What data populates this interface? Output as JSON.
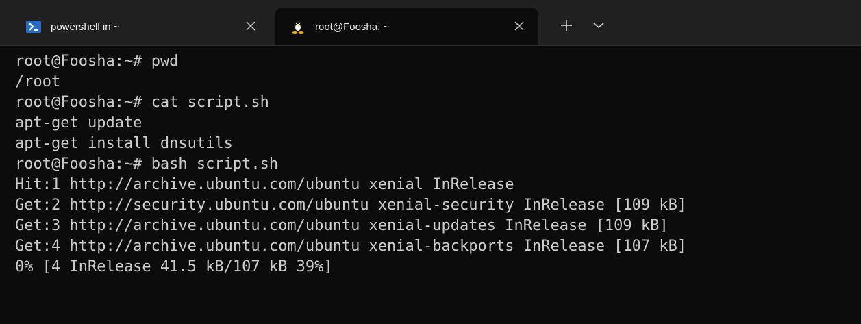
{
  "tabs": [
    {
      "title": "powershell in ~",
      "icon": "powershell-icon",
      "active": false
    },
    {
      "title": "root@Foosha: ~",
      "icon": "linux-tux-icon",
      "active": true
    }
  ],
  "tabbar": {
    "new_tab_symbol": "+",
    "dropdown_icon": "chevron-down-icon"
  },
  "terminal": {
    "prompt": "root@Foosha:~# ",
    "lines": [
      {
        "type": "command",
        "text": "pwd"
      },
      {
        "type": "output",
        "text": "/root"
      },
      {
        "type": "command",
        "text": "cat script.sh"
      },
      {
        "type": "output",
        "text": "apt-get update"
      },
      {
        "type": "output",
        "text": "apt-get install dnsutils"
      },
      {
        "type": "command",
        "text": "bash script.sh"
      },
      {
        "type": "output",
        "text": "Hit:1 http://archive.ubuntu.com/ubuntu xenial InRelease"
      },
      {
        "type": "output",
        "text": "Get:2 http://security.ubuntu.com/ubuntu xenial-security InRelease [109 kB]"
      },
      {
        "type": "output",
        "text": "Get:3 http://archive.ubuntu.com/ubuntu xenial-updates InRelease [109 kB]"
      },
      {
        "type": "output",
        "text": "Get:4 http://archive.ubuntu.com/ubuntu xenial-backports InRelease [107 kB]"
      },
      {
        "type": "output",
        "text": "0% [4 InRelease 41.5 kB/107 kB 39%]"
      }
    ]
  },
  "colors": {
    "background": "#0c0c0c",
    "tabbar": "#202020",
    "text": "#cccccc",
    "powershell_blue": "#2a6cc4"
  }
}
